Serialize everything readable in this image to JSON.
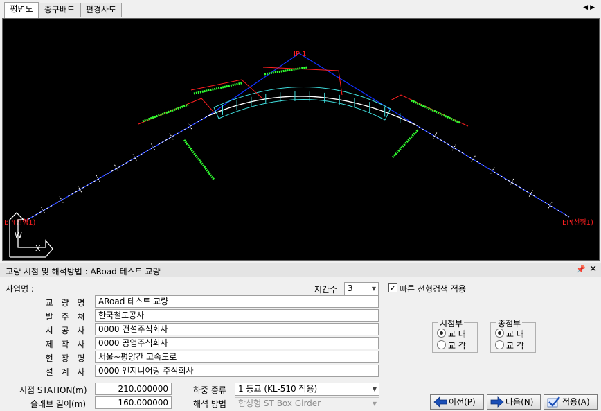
{
  "tabs": [
    {
      "label": "평면도",
      "active": true
    },
    {
      "label": "종구배도",
      "active": false
    },
    {
      "label": "편경사도",
      "active": false
    }
  ],
  "tab_nav": {
    "prev": "◀",
    "next": "▶"
  },
  "canvas": {
    "labels": {
      "ip": "IP 1",
      "bp": "BP(선형1)",
      "ep": "EP(선형1)"
    },
    "axis": {
      "w": "W",
      "x": "X"
    },
    "colors": {
      "background": "#000000",
      "tangent": "#1030ff",
      "curve": "#ffffff",
      "offset": "#40e0e0",
      "dim": "#ff2020",
      "station": "#30ff30"
    }
  },
  "panel": {
    "title": "교량 시점 및 해석방법 : ARoad 테스트 교량",
    "pin": "📌",
    "close": "✕",
    "project_label": "사업명 :",
    "span_label": "지간수",
    "span_value": "3",
    "fast_search_label": "빠른 선형검색 적용",
    "fast_search_checked": true,
    "fields": [
      {
        "label": "교 량 명",
        "value": "ARoad 테스트 교량"
      },
      {
        "label": "발 주 처",
        "value": "한국철도공사"
      },
      {
        "label": "시 공 사",
        "value": "0000 건설주식회사"
      },
      {
        "label": "제 작 사",
        "value": "0000 공업주식회사"
      },
      {
        "label": "현 장 명",
        "value": "서울~평양간 고속도로"
      },
      {
        "label": "설 계 사",
        "value": "0000 엔지니어링 주식회사"
      }
    ],
    "start_station_label": "시점 STATION(m)",
    "start_station_value": "210.000000",
    "slab_length_label": "슬래브 길이(m)",
    "slab_length_value": "160.000000",
    "load_type_label": "하중 종류",
    "load_type_value": "1 등교 (KL-510 적용)",
    "analysis_label": "해석 방법",
    "analysis_value": "합성형 ST Box Girder",
    "start_group": {
      "title": "시점부",
      "opt1": "교 대",
      "opt2": "교 각",
      "selected": 1
    },
    "end_group": {
      "title": "종점부",
      "opt1": "교 대",
      "opt2": "교 각",
      "selected": 1
    },
    "buttons": {
      "prev": "이전(P)",
      "next": "다음(N)",
      "apply": "적용(A)"
    }
  }
}
